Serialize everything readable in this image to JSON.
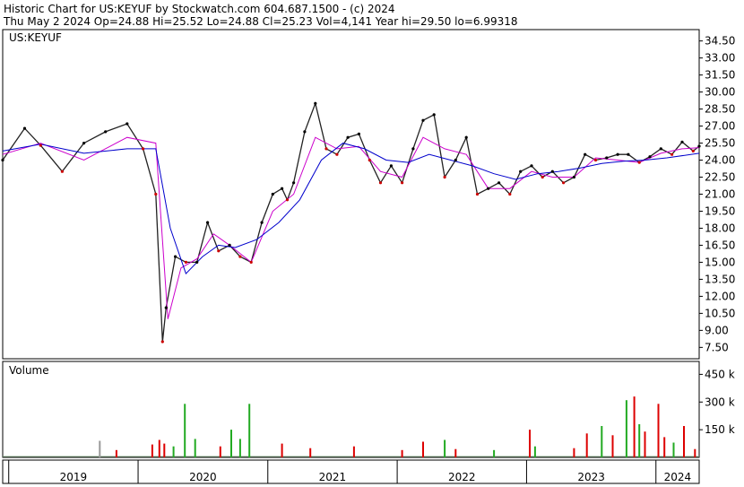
{
  "header": {
    "line1": "Historic Chart for US:KEYUF by Stockwatch.com 604.687.1500 - (c) 2024",
    "line2": "Thu May  2 2024  Op=24.88  Hi=25.52  Lo=24.88  Cl=25.23  Vol=4,141  Year hi=29.50  lo=6.99318"
  },
  "colors": {
    "price_up": "#000000",
    "price_down": "#cc0000",
    "ma_short": "#cc00cc",
    "ma_long": "#0000cc",
    "vol_up": "#22aa22",
    "vol_down": "#dd0000",
    "vol_neutral": "#999999",
    "axis": "#000000",
    "background": "#ffffff"
  },
  "chart_data": [
    {
      "type": "line",
      "title": "US:KEYUF",
      "ylabel": "",
      "ylim": [
        6.5,
        35.5
      ],
      "y_ticks": [
        "34.50",
        "33.00",
        "31.50",
        "30.00",
        "28.50",
        "27.00",
        "25.50",
        "24.00",
        "22.50",
        "21.00",
        "19.50",
        "18.00",
        "16.50",
        "15.00",
        "13.50",
        "12.00",
        "10.50",
        "9.00",
        "7.50"
      ],
      "x_tick_labels": [
        "2019",
        "2020",
        "2021",
        "2022",
        "2023",
        "2024"
      ],
      "x_range": [
        "2018-12-15",
        "2024-05-02"
      ],
      "series": [
        {
          "role": "price",
          "x": [
            "2018-12-15",
            "2019-02-15",
            "2019-04-01",
            "2019-06-01",
            "2019-08-01",
            "2019-10-01",
            "2019-12-01",
            "2020-01-15",
            "2020-02-20",
            "2020-03-10",
            "2020-03-20",
            "2020-04-15",
            "2020-05-15",
            "2020-06-15",
            "2020-07-15",
            "2020-08-15",
            "2020-09-15",
            "2020-10-15",
            "2020-11-15",
            "2020-12-15",
            "2021-01-15",
            "2021-02-10",
            "2021-02-25",
            "2021-03-15",
            "2021-04-15",
            "2021-05-15",
            "2021-06-15",
            "2021-07-15",
            "2021-08-15",
            "2021-09-15",
            "2021-10-15",
            "2021-11-15",
            "2021-12-15",
            "2022-01-15",
            "2022-02-15",
            "2022-03-15",
            "2022-04-15",
            "2022-05-15",
            "2022-06-15",
            "2022-07-15",
            "2022-08-15",
            "2022-09-15",
            "2022-10-15",
            "2022-11-15",
            "2022-12-15",
            "2023-01-15",
            "2023-02-15",
            "2023-03-15",
            "2023-04-15",
            "2023-05-15",
            "2023-06-15",
            "2023-07-15",
            "2023-08-15",
            "2023-09-15",
            "2023-10-15",
            "2023-11-15",
            "2023-12-15",
            "2024-01-15",
            "2024-02-15",
            "2024-03-15",
            "2024-04-15",
            "2024-05-02"
          ],
          "y": [
            24.0,
            26.8,
            25.3,
            23.0,
            25.5,
            26.5,
            27.2,
            25.0,
            21.0,
            8.0,
            11.0,
            15.5,
            15.0,
            15.0,
            18.5,
            16.0,
            16.5,
            15.5,
            15.0,
            18.5,
            21.0,
            21.5,
            20.5,
            22.0,
            26.5,
            29.0,
            25.0,
            24.5,
            26.0,
            26.3,
            24.0,
            22.0,
            23.5,
            22.0,
            25.0,
            27.5,
            28.0,
            22.5,
            24.0,
            26.0,
            21.0,
            21.5,
            22.0,
            21.0,
            23.0,
            23.5,
            22.5,
            23.0,
            22.0,
            22.5,
            24.5,
            24.0,
            24.2,
            24.5,
            24.5,
            23.8,
            24.3,
            25.0,
            24.5,
            25.6,
            24.8,
            25.23
          ]
        },
        {
          "role": "moving-average-short",
          "x": [
            "2018-12-15",
            "2019-04-01",
            "2019-08-01",
            "2019-12-01",
            "2020-02-20",
            "2020-03-25",
            "2020-05-01",
            "2020-06-15",
            "2020-08-01",
            "2020-09-15",
            "2020-11-15",
            "2021-01-15",
            "2021-03-15",
            "2021-05-15",
            "2021-07-15",
            "2021-09-15",
            "2021-11-15",
            "2022-01-15",
            "2022-03-15",
            "2022-05-15",
            "2022-07-15",
            "2022-09-15",
            "2022-11-15",
            "2023-01-15",
            "2023-03-15",
            "2023-05-15",
            "2023-07-15",
            "2023-09-15",
            "2023-11-15",
            "2024-01-15",
            "2024-03-15",
            "2024-05-02"
          ],
          "y": [
            24.5,
            25.5,
            24.0,
            26.0,
            25.5,
            10.0,
            14.5,
            15.3,
            17.5,
            16.5,
            15.0,
            19.5,
            21.0,
            26.0,
            25.0,
            25.2,
            23.0,
            22.5,
            26.0,
            25.0,
            24.5,
            21.5,
            21.5,
            23.0,
            22.5,
            22.5,
            24.2,
            24.0,
            23.8,
            24.6,
            25.0,
            25.1
          ]
        },
        {
          "role": "moving-average-long",
          "x": [
            "2018-12-15",
            "2019-04-01",
            "2019-08-01",
            "2019-12-01",
            "2020-02-20",
            "2020-04-01",
            "2020-05-15",
            "2020-07-01",
            "2020-08-15",
            "2020-10-01",
            "2020-12-01",
            "2021-02-01",
            "2021-04-01",
            "2021-06-01",
            "2021-08-01",
            "2021-10-01",
            "2021-12-01",
            "2022-02-01",
            "2022-04-01",
            "2022-06-01",
            "2022-08-01",
            "2022-10-01",
            "2022-12-01",
            "2023-02-01",
            "2023-04-01",
            "2023-06-01",
            "2023-08-01",
            "2023-10-01",
            "2023-12-01",
            "2024-02-01",
            "2024-05-02"
          ],
          "y": [
            24.8,
            25.4,
            24.6,
            25.0,
            25.0,
            18.0,
            14.0,
            15.5,
            16.5,
            16.3,
            17.0,
            18.5,
            20.5,
            24.0,
            25.5,
            25.0,
            24.0,
            23.8,
            24.5,
            24.0,
            23.5,
            22.8,
            22.3,
            22.8,
            23.0,
            23.3,
            23.7,
            23.9,
            24.0,
            24.2,
            24.6
          ]
        }
      ]
    },
    {
      "type": "bar",
      "title": "Volume",
      "ylabel": "",
      "ylim": [
        0,
        520
      ],
      "y_ticks": [
        "450 k",
        "300 k",
        "150 k"
      ],
      "x_range": [
        "2018-12-15",
        "2024-05-02"
      ],
      "bars": [
        {
          "x": "2019-09-15",
          "v": 90,
          "dir": "neutral"
        },
        {
          "x": "2019-11-01",
          "v": 40,
          "dir": "down"
        },
        {
          "x": "2020-02-10",
          "v": 70,
          "dir": "down"
        },
        {
          "x": "2020-03-01",
          "v": 95,
          "dir": "down"
        },
        {
          "x": "2020-03-15",
          "v": 75,
          "dir": "down"
        },
        {
          "x": "2020-04-10",
          "v": 60,
          "dir": "up"
        },
        {
          "x": "2020-05-12",
          "v": 290,
          "dir": "up"
        },
        {
          "x": "2020-06-10",
          "v": 100,
          "dir": "up"
        },
        {
          "x": "2020-08-20",
          "v": 60,
          "dir": "down"
        },
        {
          "x": "2020-09-20",
          "v": 150,
          "dir": "up"
        },
        {
          "x": "2020-10-15",
          "v": 100,
          "dir": "up"
        },
        {
          "x": "2020-11-10",
          "v": 290,
          "dir": "up"
        },
        {
          "x": "2021-02-10",
          "v": 75,
          "dir": "down"
        },
        {
          "x": "2021-05-01",
          "v": 50,
          "dir": "down"
        },
        {
          "x": "2021-09-01",
          "v": 60,
          "dir": "down"
        },
        {
          "x": "2022-01-15",
          "v": 40,
          "dir": "down"
        },
        {
          "x": "2022-03-15",
          "v": 85,
          "dir": "down"
        },
        {
          "x": "2022-05-15",
          "v": 95,
          "dir": "up"
        },
        {
          "x": "2022-06-15",
          "v": 45,
          "dir": "down"
        },
        {
          "x": "2022-10-01",
          "v": 40,
          "dir": "up"
        },
        {
          "x": "2023-01-10",
          "v": 150,
          "dir": "down"
        },
        {
          "x": "2023-01-25",
          "v": 60,
          "dir": "up"
        },
        {
          "x": "2023-05-15",
          "v": 50,
          "dir": "down"
        },
        {
          "x": "2023-06-20",
          "v": 130,
          "dir": "down"
        },
        {
          "x": "2023-08-01",
          "v": 170,
          "dir": "up"
        },
        {
          "x": "2023-09-01",
          "v": 120,
          "dir": "down"
        },
        {
          "x": "2023-10-10",
          "v": 310,
          "dir": "up"
        },
        {
          "x": "2023-11-01",
          "v": 330,
          "dir": "down"
        },
        {
          "x": "2023-11-15",
          "v": 180,
          "dir": "up"
        },
        {
          "x": "2023-12-01",
          "v": 140,
          "dir": "down"
        },
        {
          "x": "2024-01-08",
          "v": 290,
          "dir": "down"
        },
        {
          "x": "2024-01-25",
          "v": 110,
          "dir": "down"
        },
        {
          "x": "2024-02-20",
          "v": 80,
          "dir": "up"
        },
        {
          "x": "2024-03-20",
          "v": 170,
          "dir": "down"
        },
        {
          "x": "2024-04-20",
          "v": 45,
          "dir": "down"
        }
      ]
    }
  ]
}
